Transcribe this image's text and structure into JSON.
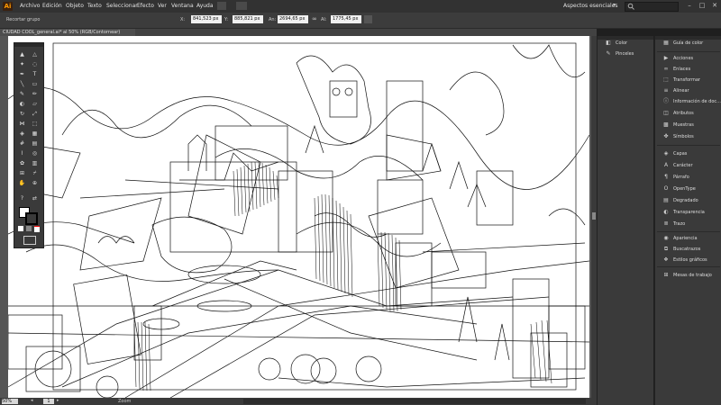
{
  "app": {
    "logo": "Ai",
    "workspace": "Aspectos esenciales"
  },
  "menu": [
    "Archivo",
    "Edición",
    "Objeto",
    "Texto",
    "Seleccionar",
    "Efecto",
    "Ver",
    "Ventana",
    "Ayuda"
  ],
  "control_bar": {
    "crop_label": "Recortar grupo",
    "x_value": "841,523 px",
    "y_value": "885,821 px",
    "w_value": "2694,65 px",
    "h_value": "1775,45 px"
  },
  "document_tab": "CIUDAD COOL_general.ai* al 50% (RGB/Contornear)",
  "status": {
    "zoom": "50%",
    "page": "1",
    "zoom_label": "Zoom"
  },
  "icons": {
    "search": "search-icon",
    "minimize": "minimize-icon",
    "maximize": "maximize-icon",
    "close": "close-icon"
  },
  "dock_left": [
    {
      "label": "Color",
      "icon": "color-icon"
    },
    {
      "label": "Pinceles",
      "icon": "brush-icon"
    }
  ],
  "dock_right": [
    {
      "label": "Guía de color",
      "icon": "color-guide-icon"
    },
    {
      "label": "Acciones",
      "icon": "actions-icon"
    },
    {
      "label": "Enlaces",
      "icon": "links-icon"
    },
    {
      "label": "Transformar",
      "icon": "transform-icon"
    },
    {
      "label": "Alinear",
      "icon": "align-icon"
    },
    {
      "label": "Información de doc...",
      "icon": "doc-info-icon"
    },
    {
      "label": "Atributos",
      "icon": "attributes-icon"
    },
    {
      "label": "Muestras",
      "icon": "swatches-icon"
    },
    {
      "label": "Símbolos",
      "icon": "symbols-icon"
    },
    {
      "label": "Capas",
      "icon": "layers-icon"
    },
    {
      "label": "Carácter",
      "icon": "character-icon"
    },
    {
      "label": "Párrafo",
      "icon": "paragraph-icon"
    },
    {
      "label": "OpenType",
      "icon": "opentype-icon"
    },
    {
      "label": "Degradado",
      "icon": "gradient-icon"
    },
    {
      "label": "Transparencia",
      "icon": "transparency-icon"
    },
    {
      "label": "Trazo",
      "icon": "stroke-icon"
    },
    {
      "label": "Apariencia",
      "icon": "appearance-icon"
    },
    {
      "label": "Buscatrazos",
      "icon": "pathfinder-icon"
    },
    {
      "label": "Estilos gráficos",
      "icon": "graphic-styles-icon"
    },
    {
      "label": "Mesas de trabajo",
      "icon": "artboards-icon"
    }
  ],
  "colors": {
    "accent": "#ff9a00",
    "ui_dark": "#323232",
    "panel": "#3a3a3a"
  }
}
